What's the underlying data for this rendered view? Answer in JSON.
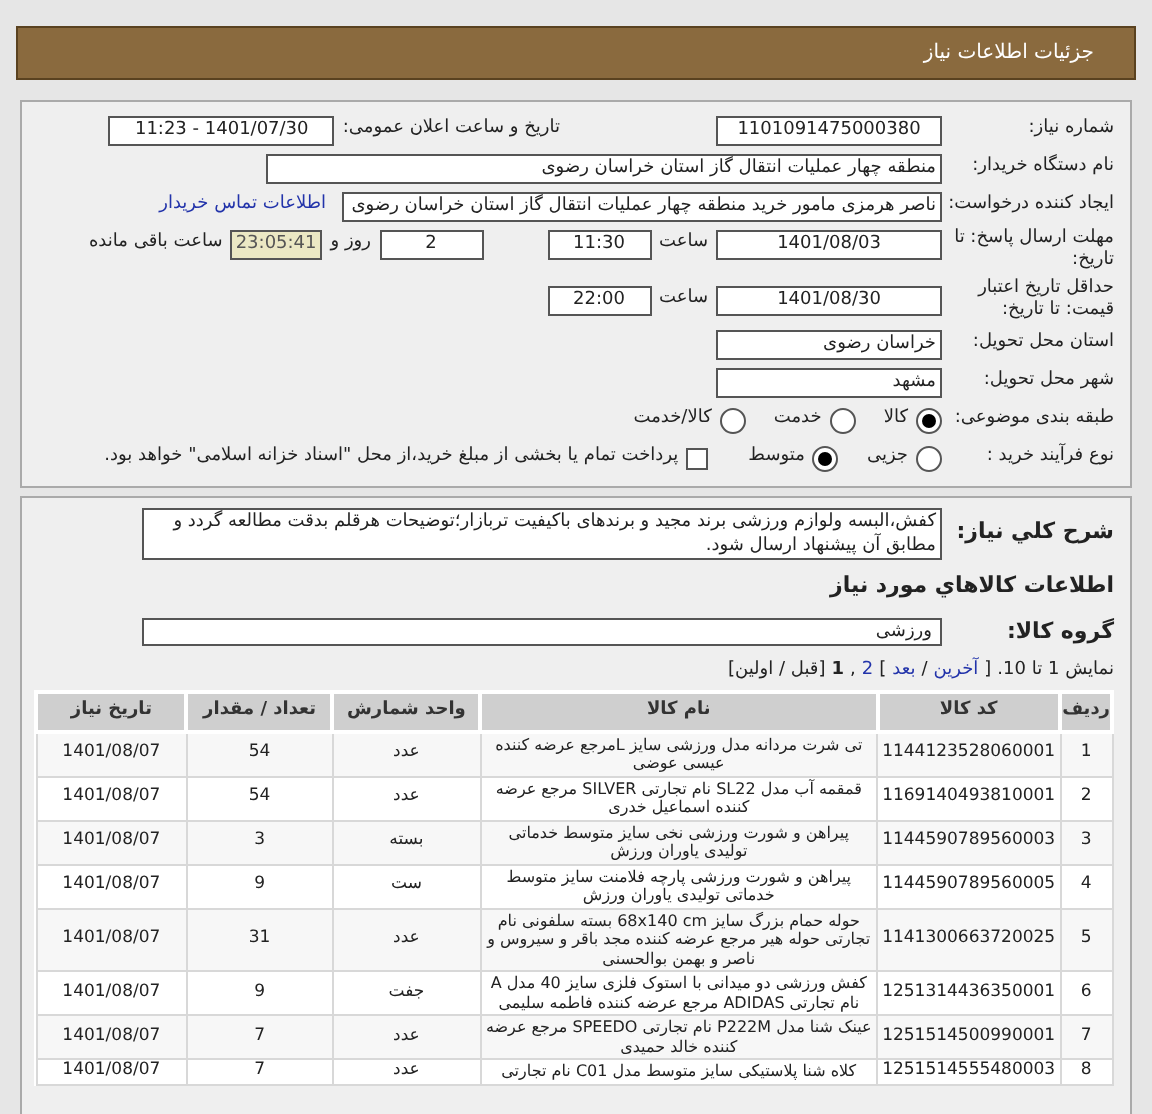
{
  "header": {
    "title": "جزئیات اطلاعات نیاز"
  },
  "need": {
    "number": {
      "label": "شماره نیاز:",
      "value": "1101091475000380"
    },
    "announce": {
      "label": "تاریخ و ساعت اعلان عمومی:",
      "value": "1401/07/30 - 11:23"
    },
    "buyer": {
      "label": "نام دستگاه خریدار:",
      "value": "منطقه چهار عملیات انتقال گاز   استان خراسان رضوی"
    },
    "requester": {
      "label": "ایجاد کننده درخواست:",
      "value": "ناصر هرمزی مامور خرید منطقه چهار عملیات انتقال گاز   استان خراسان رضوی",
      "link": "اطلاعات تماس خریدار"
    },
    "deadline": {
      "label": "مهلت ارسال پاسخ: تا تاریخ:",
      "date": "1401/08/03",
      "time_label": "ساعت",
      "time": "11:30",
      "days": "2",
      "days_label": "روز و",
      "countdown": "23:05:41",
      "remaining_label": "ساعت باقی مانده"
    },
    "validity": {
      "label": "حداقل تاریخ اعتبار قیمت: تا تاریخ:",
      "date": "1401/08/30",
      "time_label": "ساعت",
      "time": "22:00"
    },
    "province": {
      "label": "استان محل تحویل:",
      "value": "خراسان رضوی"
    },
    "city": {
      "label": "شهر محل تحویل:",
      "value": "مشهد"
    },
    "category": {
      "label": "طبقه بندی موضوعی:",
      "options": [
        {
          "label": "کالا",
          "selected": true
        },
        {
          "label": "خدمت",
          "selected": false
        },
        {
          "label": "کالا/خدمت",
          "selected": false
        }
      ]
    },
    "process": {
      "label": "نوع فرآیند خرید :",
      "options": [
        {
          "label": "جزیی",
          "selected": false
        },
        {
          "label": "متوسط",
          "selected": true
        }
      ],
      "payment": {
        "label": "پرداخت تمام یا بخشی از مبلغ خرید،از محل \"اسناد خزانه اسلامی\" خواهد بود.",
        "checked": false
      }
    }
  },
  "description": {
    "label": "شرح کلي نياز:",
    "text": "کفش،البسه ولوازم ورزشی برند مجید و برندهای باکیفیت تربازار؛توضیحات هرقلم بدقت مطالعه گردد و مطابق آن پیشنهاد ارسال شود."
  },
  "goods_heading": "اطلاعات کالاهاي مورد نياز",
  "group": {
    "label": "گروه کالا:",
    "value": "ورزشی"
  },
  "pagination": [
    {
      "kind": "text",
      "text": "نمایش 1 تا 10."
    },
    {
      "kind": "text",
      "text": "["
    },
    {
      "kind": "link",
      "text": "آخرین"
    },
    {
      "kind": "text",
      "text": "/"
    },
    {
      "kind": "link",
      "text": "بعد"
    },
    {
      "kind": "text",
      "text": "]"
    },
    {
      "kind": "link",
      "text": "2"
    },
    {
      "kind": "text",
      "text": ","
    },
    {
      "kind": "current",
      "text": "1"
    },
    {
      "kind": "text",
      "text": "[قبل / اولین]"
    }
  ],
  "table": {
    "columns": [
      "ردیف",
      "کد کالا",
      "نام کالا",
      "واحد شمارش",
      "تعداد / مقدار",
      "تاریخ نیاز"
    ],
    "rows": [
      [
        "1",
        "1144123528060001",
        "تی شرت مردانه مدل ورزشی سایز Lمرجع عرضه کننده عیسی عوضی",
        "عدد",
        "54",
        "1401/08/07"
      ],
      [
        "2",
        "1169140493810001",
        "قمقمه آب مدل SL22 نام تجارتی SILVER مرجع عرضه کننده اسماعیل خدری",
        "عدد",
        "54",
        "1401/08/07"
      ],
      [
        "3",
        "1144590789560003",
        "پیراهن و شورت ورزشی نخی سایز متوسط خدماتی تولیدی یاوران ورزش",
        "بسته",
        "3",
        "1401/08/07"
      ],
      [
        "4",
        "1144590789560005",
        "پیراهن و شورت ورزشی پارچه فلامنت سایز متوسط خدماتی تولیدی یاوران ورزش",
        "ست",
        "9",
        "1401/08/07"
      ],
      [
        "5",
        "1141300663720025",
        "حوله حمام بزرگ سایز 68x140 cm بسته سلفونی نام تجارتی حوله هیر مرجع عرضه کننده مجد باقر و سیروس و ناصر و بهمن بوالحسنی",
        "عدد",
        "31",
        "1401/08/07"
      ],
      [
        "6",
        "1251314436350001",
        "کفش ورزشی دو میدانی با استوک فلزی سایز 40 مدل A نام تجارتی ADIDAS مرجع عرضه کننده فاطمه سلیمی",
        "جفت",
        "9",
        "1401/08/07"
      ],
      [
        "7",
        "1251514500990001",
        "عینک شنا مدل P222M نام تجارتی SPEEDO مرجع عرضه کننده خالد حمیدی",
        "عدد",
        "7",
        "1401/08/07"
      ],
      [
        "8",
        "1251514555480003",
        "کلاه شنا پلاستیکی سایز متوسط مدل C01 نام تجارتی",
        "عدد",
        "7",
        "1401/08/07"
      ]
    ]
  }
}
